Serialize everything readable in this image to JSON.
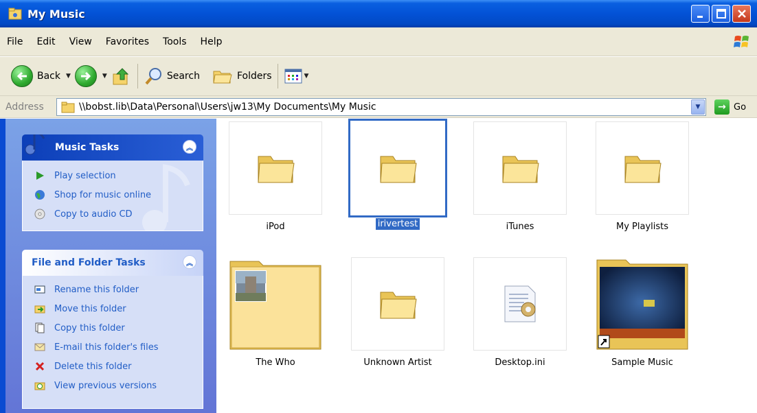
{
  "window": {
    "title": "My Music"
  },
  "menu": [
    "File",
    "Edit",
    "View",
    "Favorites",
    "Tools",
    "Help"
  ],
  "toolbar": {
    "back_label": "Back",
    "search_label": "Search",
    "folders_label": "Folders"
  },
  "address": {
    "label": "Address",
    "path": "\\\\bobst.lib\\Data\\Personal\\Users\\jw13\\My Documents\\My Music",
    "go_label": "Go"
  },
  "music_tasks": {
    "title": "Music Tasks",
    "items": [
      "Play selection",
      "Shop for music online",
      "Copy to audio CD"
    ]
  },
  "folder_tasks": {
    "title": "File and Folder Tasks",
    "items": [
      "Rename this folder",
      "Move this folder",
      "Copy this folder",
      "E-mail this folder's files",
      "Delete this folder",
      "View previous versions"
    ]
  },
  "items": [
    {
      "label": "iPod",
      "icon": "folder-icon"
    },
    {
      "label": "irivertest",
      "icon": "folder-icon",
      "selected": true
    },
    {
      "label": "iTunes",
      "icon": "folder-icon"
    },
    {
      "label": "My Playlists",
      "icon": "folder-icon"
    },
    {
      "label": "The Who",
      "icon": "folder-thumbnail"
    },
    {
      "label": "Unknown Artist",
      "icon": "folder-icon"
    },
    {
      "label": "Desktop.ini",
      "icon": "settings-file-icon"
    },
    {
      "label": "Sample Music",
      "icon": "shortcut-thumbnail"
    }
  ],
  "colors": {
    "selection": "#316ac5",
    "task_link": "#215dc6",
    "titlebar": "#0352d6"
  }
}
